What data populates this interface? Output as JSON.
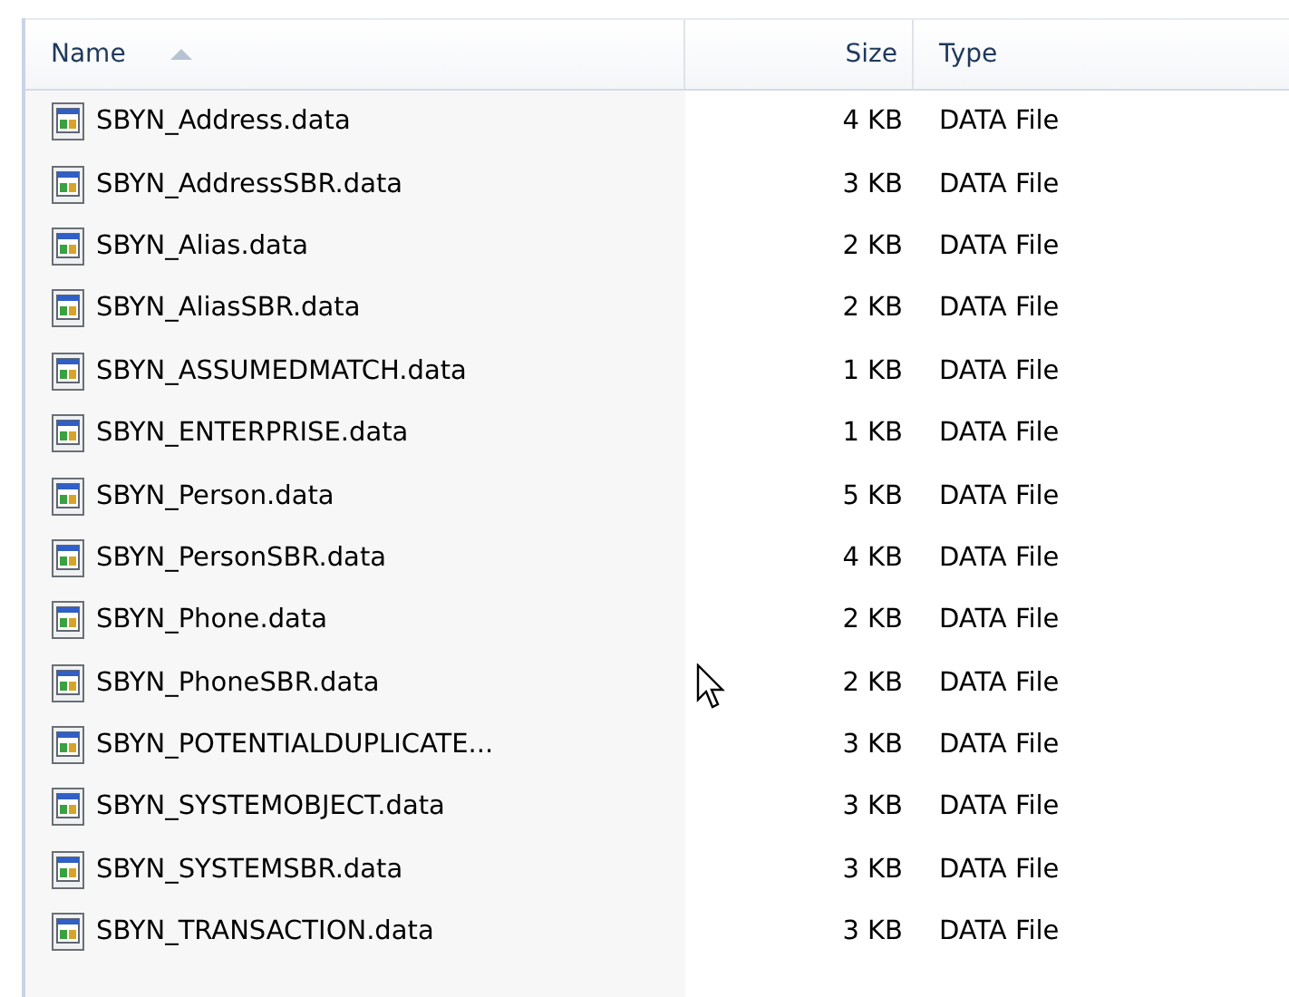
{
  "table": {
    "columns": [
      {
        "label": "Name",
        "sorted": true
      },
      {
        "label": "Size",
        "sorted": false
      },
      {
        "label": "Type",
        "sorted": false
      }
    ],
    "rows": [
      {
        "name": "SBYN_Address.data",
        "size": "4 KB",
        "type": "DATA File"
      },
      {
        "name": "SBYN_AddressSBR.data",
        "size": "3 KB",
        "type": "DATA File"
      },
      {
        "name": "SBYN_Alias.data",
        "size": "2 KB",
        "type": "DATA File"
      },
      {
        "name": "SBYN_AliasSBR.data",
        "size": "2 KB",
        "type": "DATA File"
      },
      {
        "name": "SBYN_ASSUMEDMATCH.data",
        "size": "1 KB",
        "type": "DATA File"
      },
      {
        "name": "SBYN_ENTERPRISE.data",
        "size": "1 KB",
        "type": "DATA File"
      },
      {
        "name": "SBYN_Person.data",
        "size": "5 KB",
        "type": "DATA File"
      },
      {
        "name": "SBYN_PersonSBR.data",
        "size": "4 KB",
        "type": "DATA File"
      },
      {
        "name": "SBYN_Phone.data",
        "size": "2 KB",
        "type": "DATA File"
      },
      {
        "name": "SBYN_PhoneSBR.data",
        "size": "2 KB",
        "type": "DATA File"
      },
      {
        "name": "SBYN_POTENTIALDUPLICATE...",
        "size": "3 KB",
        "type": "DATA File"
      },
      {
        "name": "SBYN_SYSTEMOBJECT.data",
        "size": "3 KB",
        "type": "DATA File"
      },
      {
        "name": "SBYN_SYSTEMSBR.data",
        "size": "3 KB",
        "type": "DATA File"
      },
      {
        "name": "SBYN_TRANSACTION.data",
        "size": "3 KB",
        "type": "DATA File"
      }
    ]
  }
}
